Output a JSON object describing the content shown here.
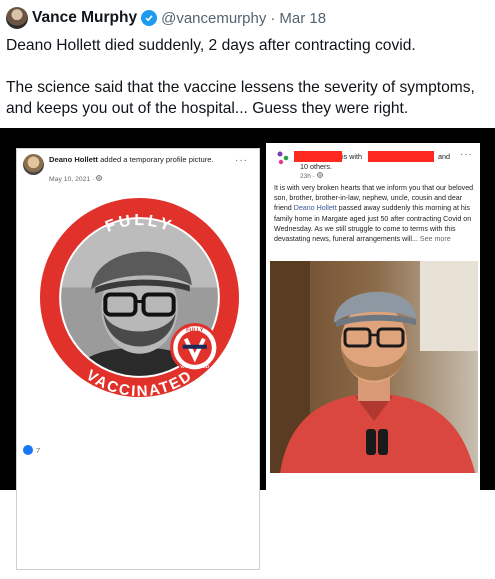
{
  "tweet": {
    "author_name": "Vance Murphy",
    "handle": "@vancemurphy",
    "separator": "·",
    "date": "Mar 18",
    "text_line1": "Deano Hollett died suddenly, 2 days after contracting covid.",
    "text_line2": "The science said that the vaccine lessens the severity of symptoms,",
    "text_line3": "and keeps you out of the hospital... Guess they were right."
  },
  "left_post": {
    "poster_name": "Deano Hollett",
    "action_text": "added a temporary profile picture.",
    "timestamp": "May 10, 2021 · ",
    "menu_dots": "···",
    "frame_top_text": "FULLY",
    "frame_bottom_text": "VACCINATED",
    "small_badge_top": "FULLY",
    "small_badge_bottom": "VACCINATED",
    "reaction_count": "7"
  },
  "right_post": {
    "is_with": "is with",
    "and": "and",
    "others": "10 others.",
    "timestamp": "23h · ",
    "menu_dots": "···",
    "body_before_link": "It is with very broken hearts that we inform you that our beloved son, brother, brother-in-law, nephew, uncle, cousin and dear friend ",
    "link_name": "Deano Hollett",
    "body_after_link": " passed away suddenly this morning at his family home in Margate aged just 50 after contracting Covid on Wednesday. As we still struggle to come to terms with this devastating news, funeral arrangements will... ",
    "see_more": "See more"
  },
  "colors": {
    "verified_badge": "#1d9bf0",
    "badge_red": "#e0312a",
    "redaction": "#ff2a1f",
    "facebook_blue": "#1877f2"
  }
}
